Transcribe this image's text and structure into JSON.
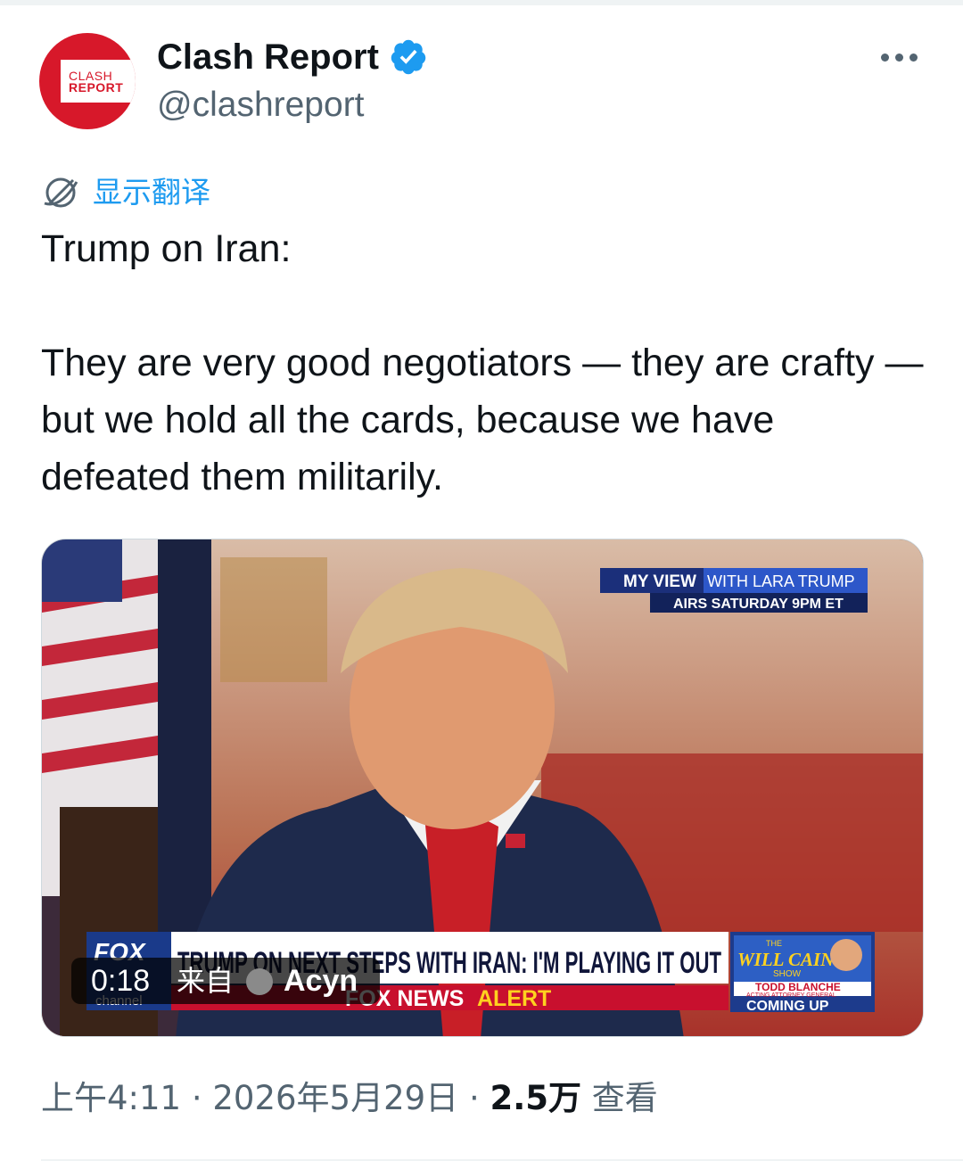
{
  "author": {
    "name": "Clash Report",
    "handle": "@clashreport",
    "avatar_text_top": "CLASH",
    "avatar_text_bottom": "REPORT",
    "verified": true
  },
  "translate": {
    "label": "显示翻译",
    "icon": "globe-icon"
  },
  "tweet": {
    "text": "Trump on Iran:\n\nThey are very good negotiators — they are crafty — but we hold all the cards, because we have defeated them militarily."
  },
  "video": {
    "duration": "0:18",
    "from_label": "来自",
    "source_name": "Acyn",
    "overlay": {
      "show_tag": "MY VIEW",
      "show_with": "WITH LARA TRUMP",
      "airs": "AIRS SATURDAY 9PM ET",
      "headline": "TRUMP ON NEXT STEPS WITH IRAN: I'M PLAYING IT OUT",
      "alert_fox": "FOX NEWS",
      "alert_word": "ALERT",
      "network_logo": "FOX",
      "network_sub": "channel",
      "promo_the": "THE",
      "promo_title": "WILL CAIN",
      "promo_show": "SHOW",
      "promo_guest": "TODD BLANCHE",
      "promo_guest_title": "ACTING ATTORNEY GENERAL",
      "promo_coming": "COMING UP"
    }
  },
  "meta": {
    "time": "上午4:11",
    "separator": "·",
    "date": "2026年5月29日",
    "views": "2.5万",
    "views_label": "查看"
  },
  "colors": {
    "accent": "#1d9bf0",
    "secondary_text": "#536471",
    "brand_red": "#d7182a"
  }
}
